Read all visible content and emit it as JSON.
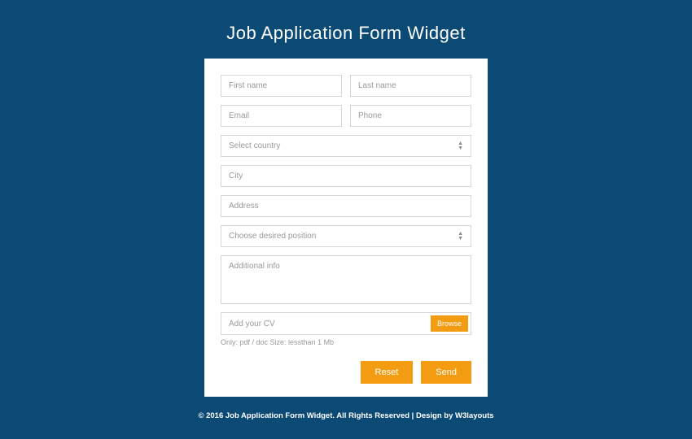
{
  "title": "Job Application Form Widget",
  "form": {
    "first_name_ph": "First name",
    "last_name_ph": "Last name",
    "email_ph": "Email",
    "phone_ph": "Phone",
    "country_ph": "Select country",
    "city_ph": "City",
    "address_ph": "Address",
    "position_ph": "Choose desired position",
    "info_ph": "Additional info",
    "cv_ph": "Add your CV",
    "browse_label": "Browse",
    "cv_hint": "Only: pdf / doc Size: lessthan 1 Mb",
    "reset_label": "Reset",
    "send_label": "Send"
  },
  "footer": {
    "copyright": "© 2016 Job Application Form Widget. All Rights Reserved | Design by ",
    "link_label": "W3layouts"
  },
  "colors": {
    "background": "#0c4a76",
    "accent": "#f39c12"
  }
}
